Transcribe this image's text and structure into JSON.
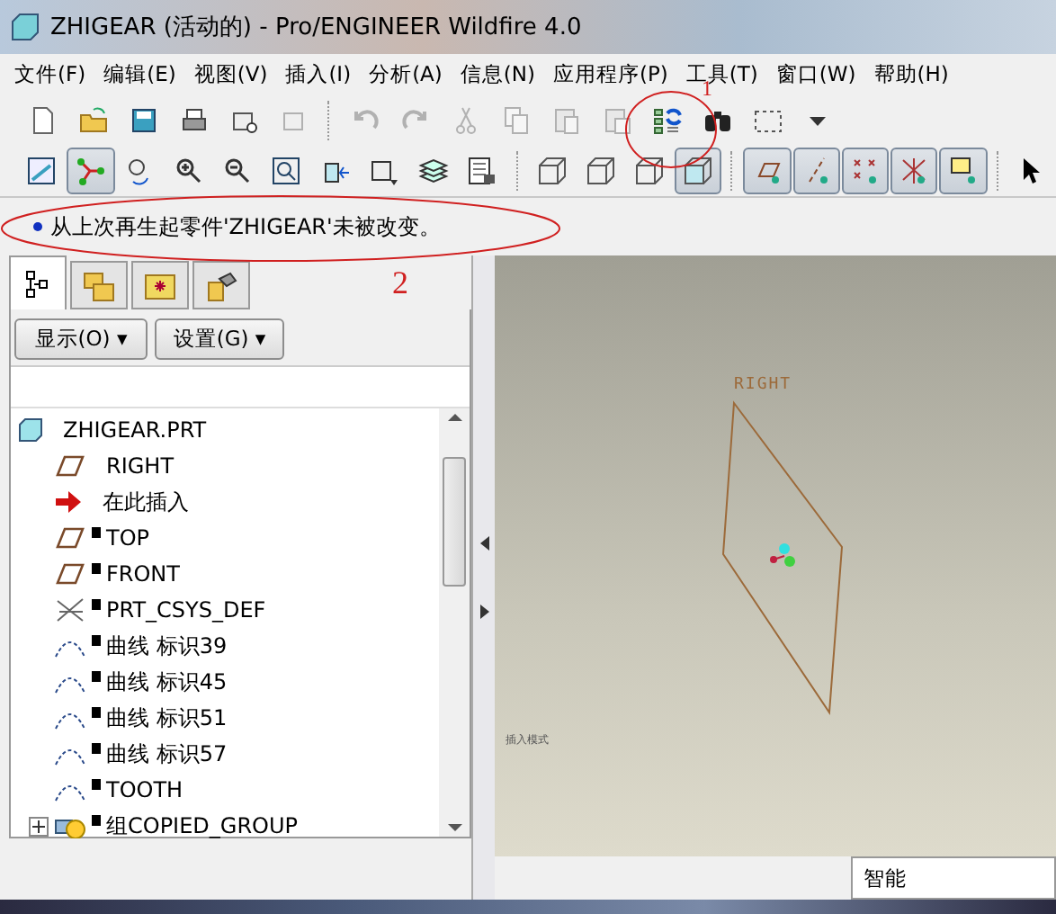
{
  "window": {
    "title": "ZHIGEAR (活动的) - Pro/ENGINEER Wildfire 4.0"
  },
  "menu": [
    "文件(F)",
    "编辑(E)",
    "视图(V)",
    "插入(I)",
    "分析(A)",
    "信息(N)",
    "应用程序(P)",
    "工具(T)",
    "窗口(W)",
    "帮助(H)"
  ],
  "toolbars": [
    {
      "buttons": [
        {
          "pressed": false,
          "disabled": false
        },
        {
          "pressed": false,
          "disabled": false
        },
        {
          "pressed": false,
          "disabled": false
        },
        {
          "pressed": false,
          "disabled": false
        },
        {
          "pressed": false,
          "disabled": false
        },
        {
          "pressed": false,
          "disabled": true
        },
        {
          "pressed": false,
          "disabled": true
        },
        {
          "pressed": false,
          "disabled": true
        },
        {
          "pressed": false,
          "disabled": true
        },
        {
          "pressed": false,
          "disabled": true
        },
        {
          "pressed": false,
          "disabled": true
        },
        {
          "pressed": false,
          "disabled": true
        },
        {
          "pressed": false,
          "disabled": false
        },
        {
          "pressed": false,
          "disabled": false
        },
        {
          "pressed": false,
          "disabled": false
        },
        {
          "pressed": false,
          "disabled": false
        }
      ]
    },
    {
      "buttons": [
        {
          "pressed": false,
          "disabled": false
        },
        {
          "pressed": true,
          "disabled": false
        },
        {
          "pressed": false,
          "disabled": false
        },
        {
          "pressed": false,
          "disabled": false
        },
        {
          "pressed": false,
          "disabled": false
        },
        {
          "pressed": false,
          "disabled": false
        },
        {
          "pressed": false,
          "disabled": false
        },
        {
          "pressed": false,
          "disabled": false
        },
        {
          "pressed": false,
          "disabled": false
        },
        {
          "pressed": false,
          "disabled": false
        },
        {
          "pressed": false,
          "disabled": false
        },
        {
          "pressed": false,
          "disabled": false
        },
        {
          "pressed": false,
          "disabled": false
        },
        {
          "pressed": true,
          "disabled": false
        },
        {
          "pressed": true,
          "disabled": false
        },
        {
          "pressed": true,
          "disabled": false
        },
        {
          "pressed": true,
          "disabled": false
        },
        {
          "pressed": true,
          "disabled": false
        },
        {
          "pressed": true,
          "disabled": false
        },
        {
          "pressed": false,
          "disabled": false
        }
      ]
    }
  ],
  "message": "从上次再生起零件'ZHIGEAR'未被改变。",
  "annotations": [
    {
      "label": "1"
    },
    {
      "label": "2"
    }
  ],
  "navigator": {
    "tabs": [
      {
        "selected": true
      },
      {
        "selected": false
      },
      {
        "selected": false
      },
      {
        "selected": false
      }
    ],
    "buttons": [
      "显示(O) ▾",
      "设置(G) ▾"
    ],
    "tree": [
      {
        "kind": "part",
        "label": "ZHIGEAR.PRT",
        "marked": false,
        "collapsed": false
      },
      {
        "kind": "plane",
        "label": "RIGHT",
        "marked": false,
        "collapsed": false
      },
      {
        "kind": "insert",
        "label": "在此插入",
        "marked": false,
        "collapsed": false
      },
      {
        "kind": "plane",
        "label": "TOP",
        "marked": true,
        "collapsed": false
      },
      {
        "kind": "plane",
        "label": "FRONT",
        "marked": true,
        "collapsed": false
      },
      {
        "kind": "csys",
        "label": "PRT_CSYS_DEF",
        "marked": true,
        "collapsed": false
      },
      {
        "kind": "curve",
        "label": "曲线 标识39",
        "marked": true,
        "collapsed": false
      },
      {
        "kind": "curve",
        "label": "曲线 标识45",
        "marked": true,
        "collapsed": false
      },
      {
        "kind": "curve",
        "label": "曲线 标识51",
        "marked": true,
        "collapsed": false
      },
      {
        "kind": "curve",
        "label": "曲线 标识57",
        "marked": true,
        "collapsed": false
      },
      {
        "kind": "curve",
        "label": "TOOTH",
        "marked": true,
        "collapsed": false
      },
      {
        "kind": "group",
        "label": "组COPIED_GROUP",
        "marked": true,
        "collapsed": true
      }
    ]
  },
  "viewport": {
    "plane_label": "RIGHT",
    "mode_note": "插入模式"
  },
  "status_bar": {
    "filter": "智能"
  }
}
